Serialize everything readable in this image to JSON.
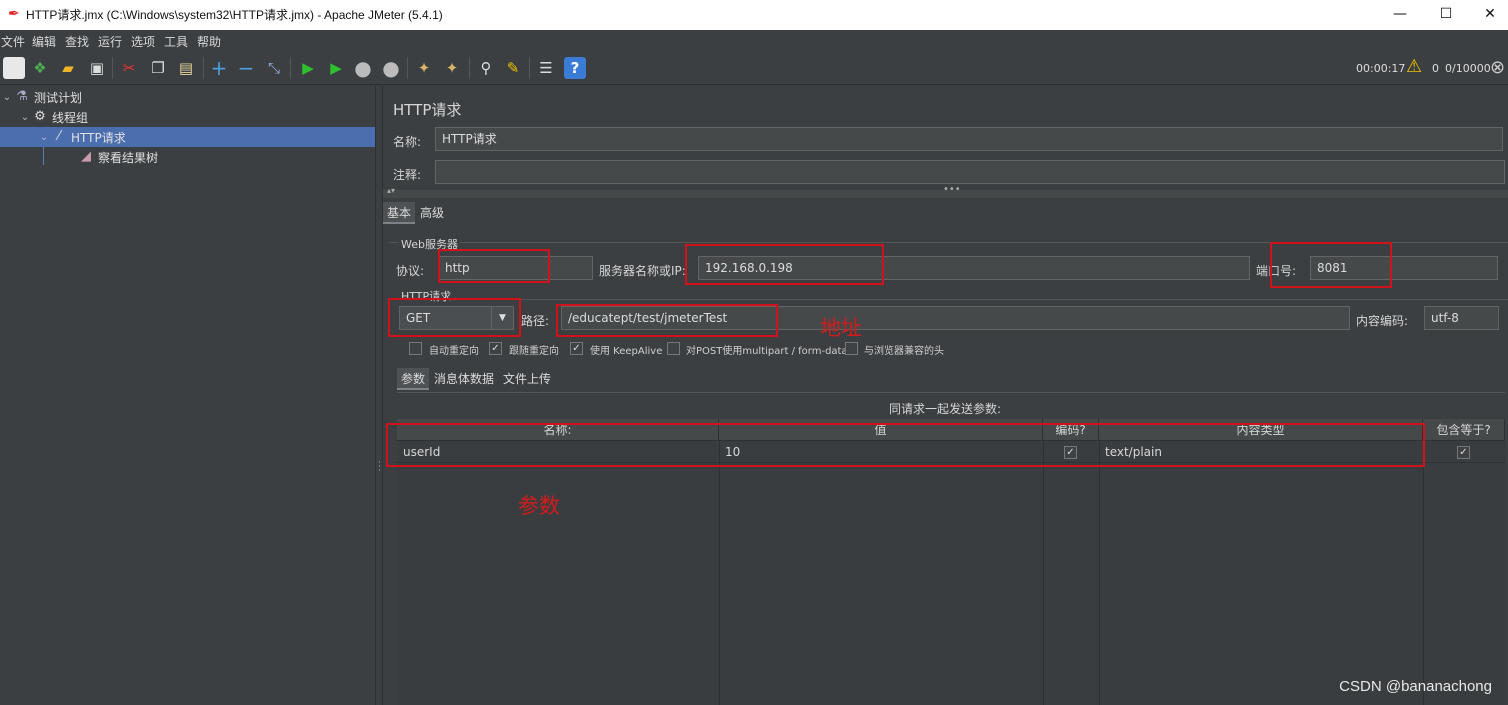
{
  "window": {
    "title": "HTTP请求.jmx (C:\\Windows\\system32\\HTTP请求.jmx) - Apache JMeter (5.4.1)",
    "minimize": "—",
    "maximize": "☐",
    "close": "✕"
  },
  "menu": [
    "文件",
    "编辑",
    "查找",
    "运行",
    "选项",
    "工具",
    "帮助"
  ],
  "toolbar_icons": [
    "new-icon",
    "templates-icon",
    "open-icon",
    "save-icon",
    "cut-icon",
    "copy-icon",
    "paste-icon",
    "expand-icon",
    "collapse-icon",
    "toggle-icon",
    "start-icon",
    "start-no-pause-icon",
    "stop-icon",
    "shutdown-icon",
    "clear-icon",
    "clear-all-icon",
    "search-icon",
    "reset-search-icon",
    "function-helper-icon",
    "help-icon"
  ],
  "status": {
    "elapsed": "00:00:17",
    "warnings": "0",
    "threads": "0/10000"
  },
  "tree": {
    "items": [
      {
        "label": "测试计划"
      },
      {
        "label": "线程组"
      },
      {
        "label": "HTTP请求"
      },
      {
        "label": "察看结果树"
      }
    ]
  },
  "panel": {
    "title": "HTTP请求",
    "name_label": "名称:",
    "name_value": "HTTP请求",
    "comment_label": "注释:",
    "comment_value": "",
    "tabs": [
      "基本",
      "高级"
    ],
    "web_server_section": "Web服务器",
    "protocol_label": "协议:",
    "protocol_value": "http",
    "server_label": "服务器名称或IP:",
    "server_value": "192.168.0.198",
    "port_label": "端口号:",
    "port_value": "8081",
    "http_request_section": "HTTP请求",
    "method_value": "GET",
    "path_label": "路径:",
    "path_value": "/educatept/test/jmeterTest",
    "encoding_label": "内容编码:",
    "encoding_value": "utf-8",
    "checkboxes": [
      {
        "label": "自动重定向",
        "checked": false
      },
      {
        "label": "跟随重定向",
        "checked": true
      },
      {
        "label": "使用 KeepAlive",
        "checked": true
      },
      {
        "label": "对POST使用multipart / form-data",
        "checked": false
      },
      {
        "label": "与浏览器兼容的头",
        "checked": false
      }
    ],
    "sub_tabs": [
      "参数",
      "消息体数据",
      "文件上传"
    ],
    "params_caption": "同请求一起发送参数:",
    "table": {
      "headers": [
        "名称:",
        "值",
        "编码?",
        "内容类型",
        "包含等于?"
      ],
      "rows": [
        {
          "name": "userId",
          "value": "10",
          "encode": true,
          "content_type": "text/plain",
          "include_equals": true
        }
      ]
    }
  },
  "annotations": {
    "address": "地址",
    "params": "参数"
  },
  "watermark": "CSDN @bananachong"
}
